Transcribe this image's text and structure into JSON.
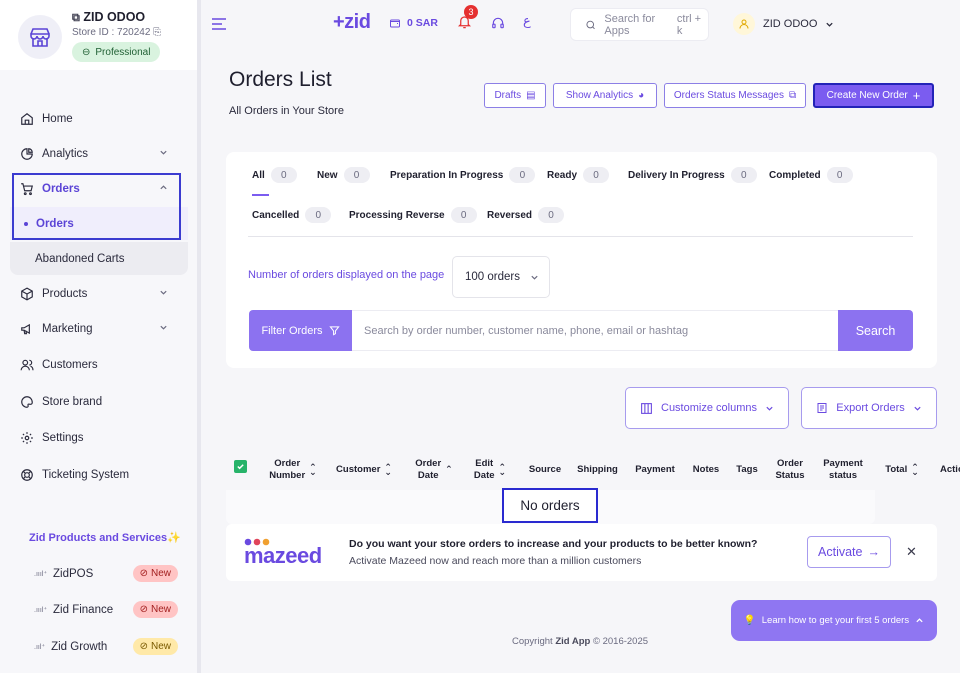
{
  "store": {
    "name": "ZID ODOO",
    "id_text": "Store ID : 720242",
    "plan": "Professional"
  },
  "sidebar": {
    "items": [
      {
        "label": "Home"
      },
      {
        "label": "Analytics"
      },
      {
        "label": "Orders"
      },
      {
        "label": "Products"
      },
      {
        "label": "Marketing"
      },
      {
        "label": "Customers"
      },
      {
        "label": "Store brand"
      },
      {
        "label": "Settings"
      },
      {
        "label": "Ticketing System"
      }
    ],
    "orders_sub": [
      {
        "label": "Orders"
      },
      {
        "label": "Abandoned Carts"
      }
    ],
    "services_title": "Zid Products and Services",
    "services": [
      {
        "label": "ZidPOS",
        "badge": "New"
      },
      {
        "label": "Zid Finance",
        "badge": "New"
      },
      {
        "label": "Zid Growth",
        "badge": "New"
      }
    ]
  },
  "topbar": {
    "logo": "+zid",
    "balance": "0 SAR",
    "notifications": "3",
    "lang": "ع",
    "search_placeholder": "Search for Apps",
    "search_shortcut": "ctrl + k",
    "user": "ZID ODOO"
  },
  "page": {
    "title": "Orders List",
    "subtitle": "All Orders in Your Store",
    "buttons": {
      "drafts": "Drafts",
      "analytics": "Show Analytics",
      "status_messages": "Orders Status Messages",
      "create": "Create New Order"
    }
  },
  "tabs": [
    {
      "label": "All",
      "count": "0"
    },
    {
      "label": "New",
      "count": "0"
    },
    {
      "label": "Preparation In Progress",
      "count": "0"
    },
    {
      "label": "Ready",
      "count": "0"
    },
    {
      "label": "Delivery In Progress",
      "count": "0"
    },
    {
      "label": "Completed",
      "count": "0"
    },
    {
      "label": "Cancelled",
      "count": "0"
    },
    {
      "label": "Processing Reverse",
      "count": "0"
    },
    {
      "label": "Reversed",
      "count": "0"
    }
  ],
  "filters": {
    "per_page_label": "Number of orders displayed on the page",
    "per_page_value": "100 orders",
    "filter_button": "Filter Orders",
    "search_placeholder": "Search by order number, customer name, phone, email or hashtag",
    "search_button": "Search"
  },
  "tools": {
    "customize": "Customize columns",
    "export": "Export Orders"
  },
  "table": {
    "columns": {
      "order_number": [
        "Order",
        "Number"
      ],
      "customer": "Customer",
      "order_date": [
        "Order",
        "Date"
      ],
      "edit_date": [
        "Edit",
        "Date"
      ],
      "source": "Source",
      "shipping": "Shipping",
      "payment": "Payment",
      "notes": "Notes",
      "tags": "Tags",
      "order_status": [
        "Order",
        "Status"
      ],
      "payment_status": [
        "Payment",
        "status"
      ],
      "total": "Total",
      "actions": "Actions"
    },
    "empty": "No orders"
  },
  "mazeed": {
    "logo": "mazeed",
    "title": "Do you want your store orders to increase and your products to be better known?",
    "desc": "Activate Mazeed now and reach more than a million customers",
    "button": "Activate"
  },
  "learn": "Learn how to get your first 5 orders",
  "copyright": {
    "prefix": "Copyright",
    "brand": "Zid App",
    "suffix": "© 2016-2025"
  },
  "colors": {
    "accent": "#7b5cf0",
    "highlight": "#2323b8",
    "new_badge": "#ffc4c4"
  }
}
